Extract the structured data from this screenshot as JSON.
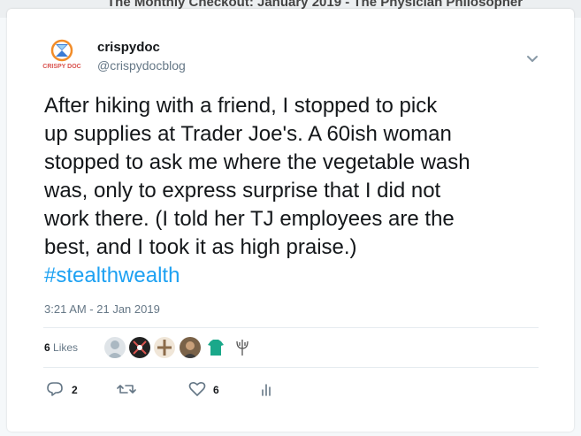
{
  "page_header": {
    "title": "The Monthly Checkout: January 2019 - The Physician Philosopher"
  },
  "tweet": {
    "author": {
      "display_name": "crispydoc",
      "handle": "@crispydocblog",
      "avatar_text": "CRISPY DOC"
    },
    "text_line1": "After hiking with a friend, I stopped to pick",
    "text_line2": "up supplies at Trader Joe's. A 60ish woman",
    "text_line3": "stopped to ask me where the vegetable wash",
    "text_line4": "was, only to express surprise that I did not",
    "text_line5": "work there. (I told her TJ employees are the",
    "text_line6": "best, and I took it as high praise.)",
    "hashtag": "#stealthwealth",
    "timestamp": "3:21 AM - 21 Jan 2019",
    "likes": {
      "count": "6",
      "label": "Likes"
    },
    "actions": {
      "reply_count": "2",
      "retweet_count": "",
      "like_count": "6"
    }
  },
  "colors": {
    "link": "#1da1f2",
    "text": "#14171a",
    "muted": "#657786"
  },
  "icons": [
    "chevron-down-icon",
    "reply-icon",
    "retweet-icon",
    "heart-icon",
    "analytics-icon"
  ]
}
